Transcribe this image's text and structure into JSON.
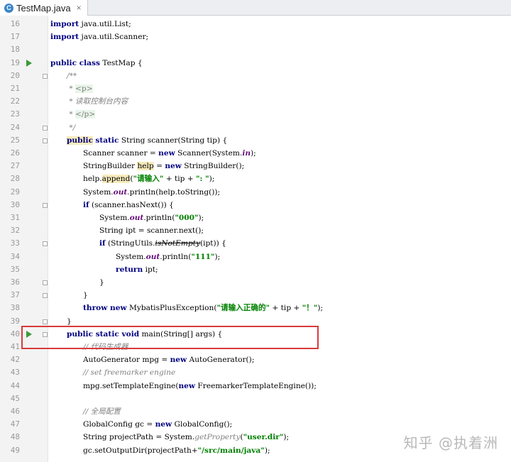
{
  "tab": {
    "icon_letter": "C",
    "title": "TestMap.java",
    "close": "×"
  },
  "watermark": "知乎 @执着洲",
  "lines": [
    {
      "n": "16",
      "indent": 0,
      "html": "<span class=\"kw\">import</span> java.util.List;"
    },
    {
      "n": "17",
      "indent": 0,
      "html": "<span class=\"kw\">import</span> java.util.Scanner;"
    },
    {
      "n": "18",
      "indent": 0,
      "html": ""
    },
    {
      "n": "19",
      "indent": 0,
      "run": true,
      "html": "<span class=\"kw\">public class</span> TestMap {"
    },
    {
      "n": "20",
      "indent": 1,
      "fold": true,
      "html": "<span class=\"cm\">/**</span>"
    },
    {
      "n": "21",
      "indent": 1,
      "html": "<span class=\"cm\"> * </span><span class=\"tg\">&lt;p&gt;</span>"
    },
    {
      "n": "22",
      "indent": 1,
      "html": "<span class=\"cm\"> * 读取控制台内容</span>"
    },
    {
      "n": "23",
      "indent": 1,
      "html": "<span class=\"cm\"> * </span><span class=\"tg\">&lt;/p&gt;</span>"
    },
    {
      "n": "24",
      "indent": 1,
      "fold": true,
      "html": "<span class=\"cm\"> */</span>"
    },
    {
      "n": "25",
      "indent": 1,
      "fold": true,
      "html": "<span class=\"kw mark\">public</span> <span class=\"kw\">static</span> String scanner(String tip) {"
    },
    {
      "n": "26",
      "indent": 2,
      "html": "Scanner scanner = <span class=\"kw\">new</span> Scanner(System.<span class=\"fld\">in</span>);"
    },
    {
      "n": "27",
      "indent": 2,
      "html": "StringBuilder <span class=\"mark\">help</span> = <span class=\"kw\">new</span> StringBuilder();"
    },
    {
      "n": "28",
      "indent": 2,
      "html": "help.<span class=\"mark\">append</span>(<span class=\"str\">\"请输入\"</span> + tip + <span class=\"str\">\": \"</span>);"
    },
    {
      "n": "29",
      "indent": 2,
      "html": "System.<span class=\"fld\">out</span>.println(help.toString());"
    },
    {
      "n": "30",
      "indent": 2,
      "fold": true,
      "html": "<span class=\"kw\">if</span> (scanner.hasNext()) {"
    },
    {
      "n": "31",
      "indent": 3,
      "html": "System.<span class=\"fld\">out</span>.println(<span class=\"str\">\"000\"</span>);"
    },
    {
      "n": "32",
      "indent": 3,
      "html": "String ipt = scanner.next();"
    },
    {
      "n": "33",
      "indent": 3,
      "fold": true,
      "html": "<span class=\"kw\">if</span> (StringUtils.<span class=\"strike\">isNotEmpty</span>(ipt)) {"
    },
    {
      "n": "34",
      "indent": 4,
      "html": "System.<span class=\"fld\">out</span>.println(<span class=\"str\">\"111\"</span>);"
    },
    {
      "n": "35",
      "indent": 4,
      "html": "<span class=\"kw\">return</span> ipt;"
    },
    {
      "n": "36",
      "indent": 3,
      "fold": true,
      "html": "}"
    },
    {
      "n": "37",
      "indent": 2,
      "fold": true,
      "html": "}"
    },
    {
      "n": "38",
      "indent": 2,
      "html": "<span class=\"kw\">throw new</span> MybatisPlusException(<span class=\"str\">\"请输入正确的\"</span> + tip + <span class=\"str\">\"！\"</span>);"
    },
    {
      "n": "39",
      "indent": 1,
      "fold": true,
      "html": "}"
    },
    {
      "n": "40",
      "indent": 1,
      "run": true,
      "fold": true,
      "html": "<span class=\"kw\">public static void</span> main(String[] args) {"
    },
    {
      "n": "41",
      "indent": 2,
      "html": "<span class=\"cm\">// 代码生成器</span>"
    },
    {
      "n": "42",
      "indent": 2,
      "html": "AutoGenerator mpg = <span class=\"kw\">new</span> AutoGenerator();"
    },
    {
      "n": "43",
      "indent": 2,
      "html": "<span class=\"cm\">// set freemarker engine</span>"
    },
    {
      "n": "44",
      "indent": 2,
      "html": "mpg.setTemplateEngine(<span class=\"kw\">new</span> FreemarkerTemplateEngine());"
    },
    {
      "n": "45",
      "indent": 2,
      "html": ""
    },
    {
      "n": "46",
      "indent": 2,
      "html": "<span class=\"cm\">// 全局配置</span>"
    },
    {
      "n": "47",
      "indent": 2,
      "html": "GlobalConfig gc = <span class=\"kw\">new</span> GlobalConfig();"
    },
    {
      "n": "48",
      "indent": 2,
      "html": "String projectPath = System.<span class=\"cm\">getProperty</span>(<span class=\"str\">\"user.dir\"</span>);"
    },
    {
      "n": "49",
      "indent": 2,
      "html": "gc.setOutputDir(projectPath+<span class=\"str\">\"/src/main/java\"</span>);"
    }
  ]
}
